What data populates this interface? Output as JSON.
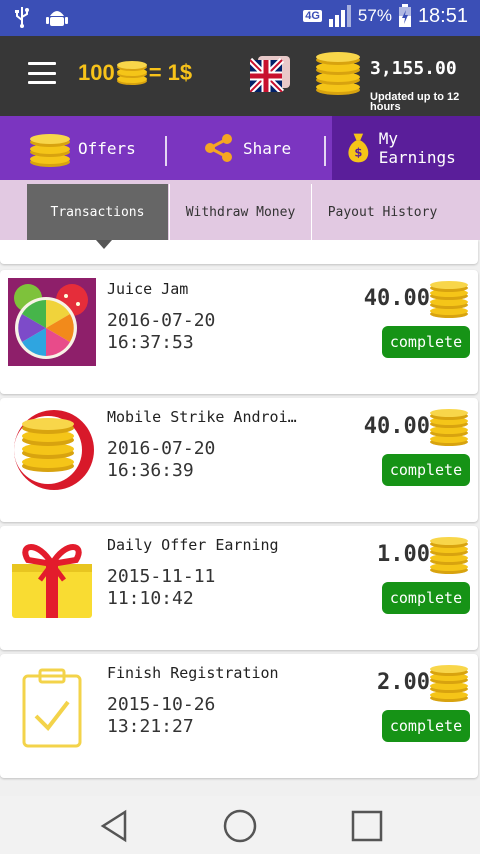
{
  "status_bar": {
    "network": "4G",
    "battery_percent": "57%",
    "time": "18:51"
  },
  "header": {
    "rate_left": "100",
    "rate_right": "= 1$",
    "balance": "3,155.00",
    "balance_note": "Updated up to 12 hours"
  },
  "main_tabs": [
    {
      "label": "Offers",
      "icon": "coins-icon",
      "active": false
    },
    {
      "label": "Share",
      "icon": "share-icon",
      "active": false
    },
    {
      "label": "My Earnings",
      "icon": "money-bag-icon",
      "active": true
    }
  ],
  "sub_tabs": [
    {
      "label": "Transactions",
      "active": true
    },
    {
      "label": "Withdraw Money",
      "active": false
    },
    {
      "label": "Payout History",
      "active": false
    }
  ],
  "transactions": [
    {
      "title": "Juice Jam",
      "date": "2016-07-20",
      "time": "16:37:53",
      "amount": "40.00",
      "status": "complete",
      "icon": "juice-jam-icon"
    },
    {
      "title": "Mobile Strike Androi…",
      "date": "2016-07-20",
      "time": "16:36:39",
      "amount": "40.00",
      "status": "complete",
      "icon": "coins-circle-icon"
    },
    {
      "title": "Daily Offer Earning",
      "date": "2015-11-11",
      "time": "11:10:42",
      "amount": "1.00",
      "status": "complete",
      "icon": "gift-icon"
    },
    {
      "title": "Finish Registration",
      "date": "2015-10-26",
      "time": "13:21:27",
      "amount": "2.00",
      "status": "complete",
      "icon": "clipboard-check-icon"
    }
  ],
  "colors": {
    "status_bar": "#3b4fb6",
    "header": "#373737",
    "tabs": "#7b35c0",
    "tab_active": "#5a1e9a",
    "subtabs": "#e2c9e2",
    "complete_badge": "#169316",
    "coin": "#f5c518"
  }
}
